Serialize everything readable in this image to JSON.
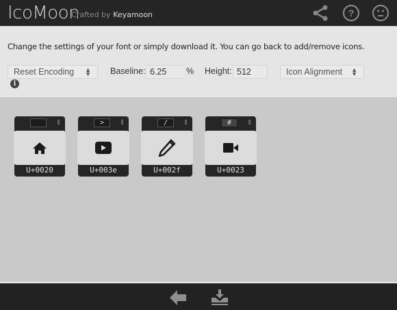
{
  "header": {
    "logo": "IcoMoon",
    "crafted_by": "Crafted by",
    "author": "Keyamoon",
    "icons": [
      "share-icon",
      "help-icon",
      "smiley-icon"
    ]
  },
  "settings": {
    "description": "Change the settings of your font or simply download it. You can go back to add/remove icons.",
    "reset_encoding": "Reset Encoding",
    "baseline_label": "Baseline:",
    "baseline_value": "6.25",
    "percent": "%",
    "height_label": "Height:",
    "height_value": "512",
    "icon_alignment": "Icon Alignment"
  },
  "glyphs": [
    {
      "icon": "home-icon",
      "char": "",
      "code": "U+0020"
    },
    {
      "icon": "youtube-play-icon",
      "char": ">",
      "code": "U+003e"
    },
    {
      "icon": "pencil-icon",
      "char": "/",
      "code": "U+002f"
    },
    {
      "icon": "video-camera-icon",
      "char": "#",
      "code": "U+0023"
    }
  ],
  "footer": {
    "icons": [
      "back-arrow-icon",
      "download-icon"
    ]
  }
}
